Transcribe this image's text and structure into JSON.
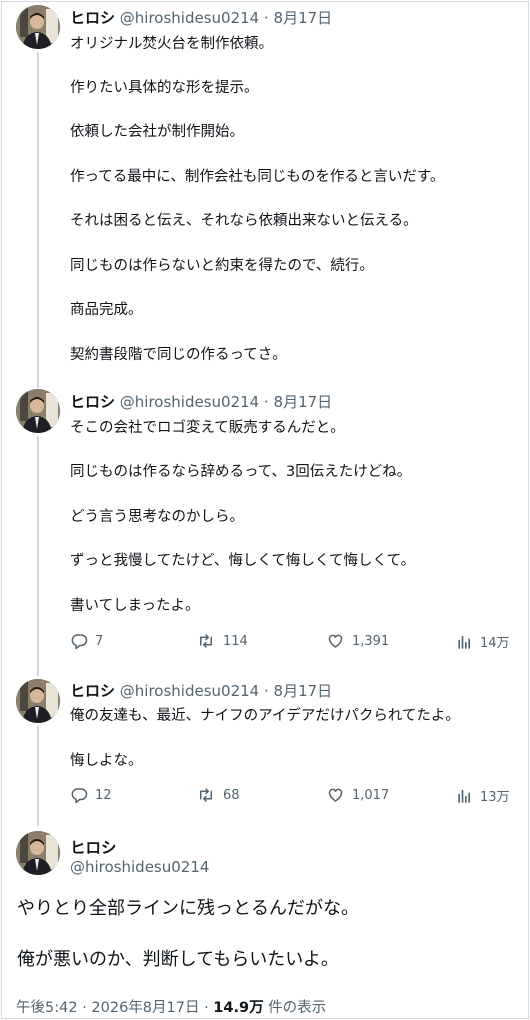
{
  "tweets": [
    {
      "name": "ヒロシ",
      "handle": "@hiroshidesu0214",
      "date": "· 8月17日",
      "paragraphs": [
        "オリジナル焚火台を制作依頼。",
        "作りたい具体的な形を提示。",
        "依頼した会社が制作開始。",
        "作ってる最中に、制作会社も同じものを作ると言いだす。",
        "それは困ると伝え、それなら依頼出来ないと伝える。",
        "同じものは作らないと約束を得たので、続行。",
        "商品完成。",
        "契約書段階で同じの作るってさ。"
      ]
    },
    {
      "name": "ヒロシ",
      "handle": "@hiroshidesu0214",
      "date": "· 8月17日",
      "paragraphs": [
        "そこの会社でロゴ変えて販売するんだと。",
        "同じものは作るなら辞めるって、3回伝えたけどね。",
        "どう言う思考なのかしら。",
        "ずっと我慢してたけど、悔しくて悔しくて悔しくて。",
        "書いてしまったよ。"
      ],
      "stats": {
        "replies": "7",
        "retweets": "114",
        "likes": "1,391",
        "views": "14万"
      }
    },
    {
      "name": "ヒロシ",
      "handle": "@hiroshidesu0214",
      "date": "· 8月17日",
      "paragraphs": [
        "俺の友達も、最近、ナイフのアイデアだけパクられてたよ。",
        "悔しよな。"
      ],
      "stats": {
        "replies": "12",
        "retweets": "68",
        "likes": "1,017",
        "views": "13万"
      }
    }
  ],
  "main": {
    "name": "ヒロシ",
    "handle": "@hiroshidesu0214",
    "paragraphs": [
      "やりとり全部ラインに残っとるんだがな。",
      "俺が悪いのか、判断してもらいたいよ。"
    ],
    "time": "午後5:42 · 2026年8月17日 · ",
    "views_count": "14.9万",
    "views_label": " 件の表示"
  },
  "icons": [
    "reply-icon",
    "retweet-icon",
    "like-icon",
    "views-icon"
  ],
  "colors": {
    "text": "#0f1419",
    "secondary": "#536471",
    "border": "#cfd9de"
  }
}
